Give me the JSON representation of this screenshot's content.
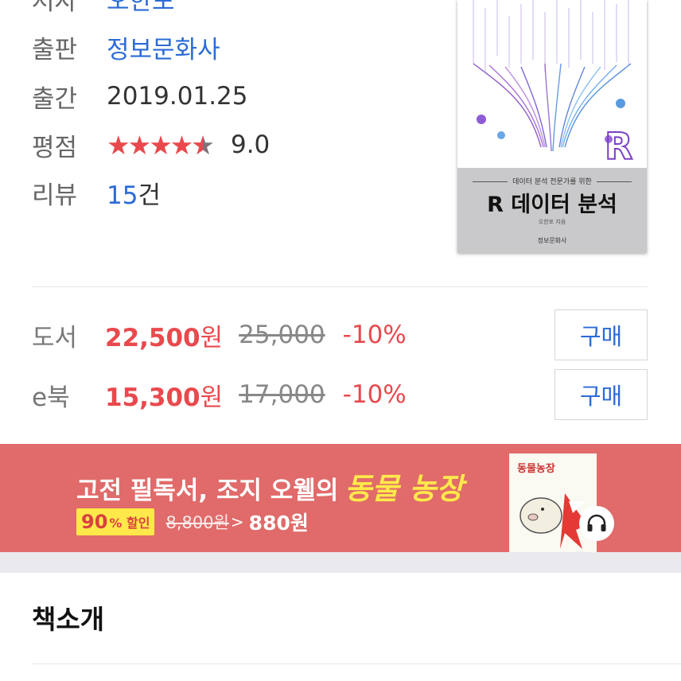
{
  "info": {
    "author_label": "저자",
    "author_value": "오한포",
    "publisher_label": "출판",
    "publisher_value": "정보문화사",
    "date_label": "출간",
    "date_value": "2019.01.25",
    "rating_label": "평점",
    "rating_value": "9.0",
    "rating_stars": 4.5,
    "review_label": "리뷰",
    "review_count": "15",
    "review_unit": "건"
  },
  "cover": {
    "subtitle": "데이터 분석 전문가를 위한",
    "title": "R 데이터 분석",
    "author": "오한포 지음",
    "publisher": "정보문화사"
  },
  "prices": [
    {
      "label": "도서",
      "sale": "22,500",
      "sale_unit": "원",
      "original": "25,000",
      "discount": "-10%",
      "button": "구매"
    },
    {
      "label": "e북",
      "sale": "15,300",
      "sale_unit": "원",
      "original": "17,000",
      "discount": "-10%",
      "button": "구매"
    }
  ],
  "banner": {
    "headline": "고전 필독서, 조지 오웰의",
    "highlight": "동물 농장",
    "discount_num": "90",
    "discount_suffix": "% 할인",
    "original_price": "8,800원",
    "new_price": "880원",
    "book_title": "동물농장"
  },
  "section": {
    "title": "책소개"
  },
  "colors": {
    "accent_red": "#e9494d",
    "link_blue": "#2b6bd6",
    "banner_bg": "#e06b6a",
    "highlight_yellow": "#ffe94a"
  }
}
